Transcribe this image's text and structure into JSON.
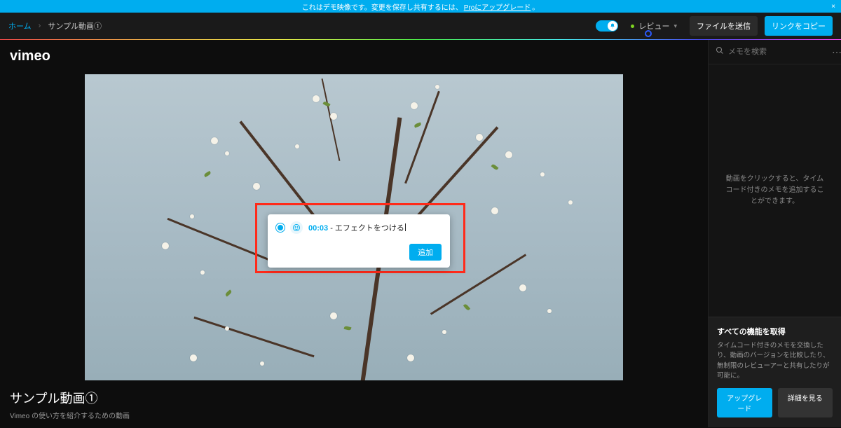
{
  "banner": {
    "text_before": "これはデモ映像です。変更を保存し共有するには、",
    "link_text": "Proにアップグレード",
    "text_after": "。"
  },
  "breadcrumb": {
    "home": "ホーム",
    "current": "サンプル動画①"
  },
  "nav": {
    "review_label": "レビュー",
    "send_file": "ファイルを送信",
    "copy_link": "リンクをコピー"
  },
  "logo": "vimeo",
  "comment": {
    "timecode": "00:03",
    "separator": " - ",
    "text": "エフェクトをつける",
    "add_button": "追加"
  },
  "video": {
    "title": "サンプル動画①",
    "subtitle": "Vimeo の使い方を紹介するための動画"
  },
  "sidebar": {
    "search_placeholder": "メモを検索",
    "hint": "動画をクリックすると、タイムコード付きのメモを追加することができます。",
    "upsell": {
      "title": "すべての機能を取得",
      "desc": "タイムコード付きのメモを交換したり、動画のバージョンを比較したり、無制限のレビューアーと共有したりが可能に。",
      "upgrade": "アップグレード",
      "details": "詳細を見る"
    }
  }
}
